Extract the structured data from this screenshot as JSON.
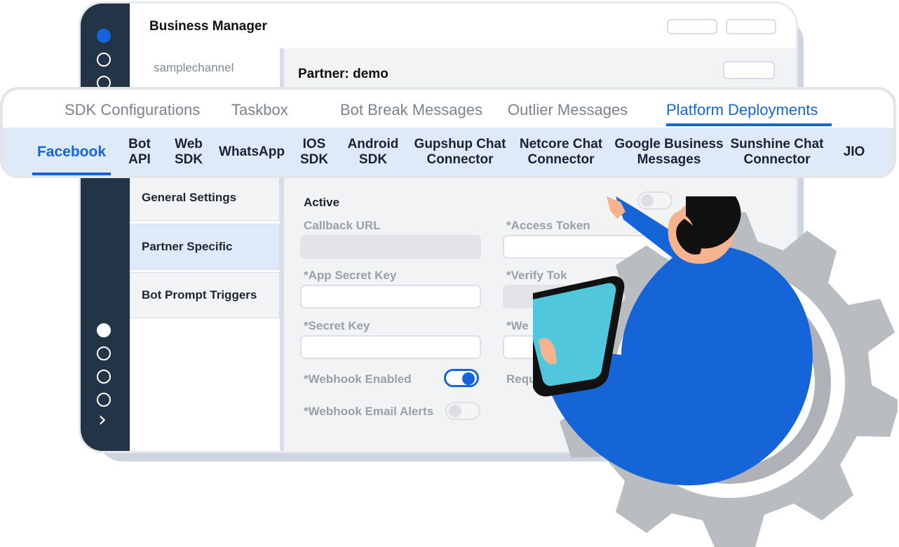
{
  "window": {
    "title": "Business Manager",
    "channel": "samplechannel",
    "partner_title": "Partner: demo"
  },
  "primary_tabs": [
    {
      "label": "SDK Configurations",
      "active": false
    },
    {
      "label": "Taskbox",
      "active": false
    },
    {
      "label": "Bot Break Messages",
      "active": false
    },
    {
      "label": "Outlier Messages",
      "active": false
    },
    {
      "label": "Platform Deployments",
      "active": true
    }
  ],
  "secondary_tabs": [
    {
      "label": "Facebook",
      "active": true
    },
    {
      "label": "Bot\nAPI",
      "active": false
    },
    {
      "label": "Web\nSDK",
      "active": false
    },
    {
      "label": "WhatsApp",
      "active": false
    },
    {
      "label": "IOS\nSDK",
      "active": false
    },
    {
      "label": "Android\nSDK",
      "active": false
    },
    {
      "label": "Gupshup Chat\nConnector",
      "active": false
    },
    {
      "label": "Netcore Chat\nConnector",
      "active": false
    },
    {
      "label": "Google Business\nMessages",
      "active": false
    },
    {
      "label": "Sunshine Chat\nConnector",
      "active": false
    },
    {
      "label": "JIO",
      "active": false
    }
  ],
  "settings_nav": [
    {
      "label": "General Settings",
      "active": false
    },
    {
      "label": "Partner Specific",
      "active": true
    },
    {
      "label": "Bot Prompt Triggers",
      "active": false
    }
  ],
  "form": {
    "active_label": "Active",
    "callback_url_label": "Callback URL",
    "access_token_label": "*Access Token",
    "app_secret_key_label": "*App Secret Key",
    "verify_token_label": "*Verify Tok",
    "secret_key_label": "*Secret Key",
    "webhook_partial_label": "*We",
    "webhook_enabled_label": "*Webhook Enabled",
    "required_partial_label": "Requir",
    "webhook_email_alerts_label": "*Webhook Email Alerts"
  },
  "toggles": {
    "webhook_enabled": true,
    "webhook_email_alerts": false
  },
  "colors": {
    "accent": "#1665d8",
    "dark_rail": "#243447",
    "selected_tab_background": "#dfeaf8",
    "illustration_shirt": "#1665d8",
    "illustration_tablet": "#50c7dc"
  },
  "icons": [
    "navigation-dot-icon",
    "chevron-right-icon",
    "toggle-icon"
  ]
}
